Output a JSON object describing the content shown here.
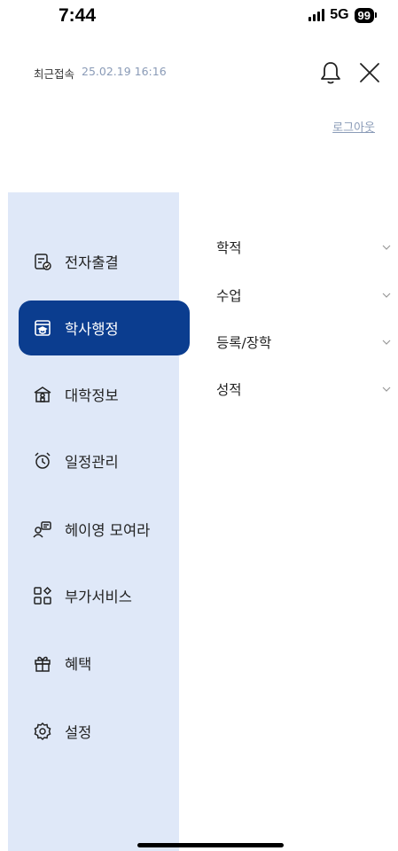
{
  "status": {
    "time": "7:44",
    "network": "5G",
    "battery": "99"
  },
  "header": {
    "last_login_label": "최근접속",
    "last_login_time": "25.02.19 16:16",
    "logout_label": "로그아웃"
  },
  "sidebar": {
    "items": [
      {
        "label": "전자출결",
        "icon": "attendance-icon",
        "active": false
      },
      {
        "label": "학사행정",
        "icon": "academic-admin-icon",
        "active": true
      },
      {
        "label": "대학정보",
        "icon": "university-info-icon",
        "active": false
      },
      {
        "label": "일정관리",
        "icon": "alarm-clock-icon",
        "active": false
      },
      {
        "label": "헤이영 모여라",
        "icon": "community-icon",
        "active": false
      },
      {
        "label": "부가서비스",
        "icon": "extra-services-icon",
        "active": false
      },
      {
        "label": "혜택",
        "icon": "gift-icon",
        "active": false
      },
      {
        "label": "설정",
        "icon": "gear-icon",
        "active": false
      }
    ]
  },
  "submenu": {
    "items": [
      {
        "label": "학적"
      },
      {
        "label": "수업"
      },
      {
        "label": "등록/장학"
      },
      {
        "label": "성적"
      }
    ]
  },
  "colors": {
    "accent": "#0b3d8f",
    "sidebar_bg": "#dfe8f8",
    "muted_text": "#8a9bb7"
  }
}
